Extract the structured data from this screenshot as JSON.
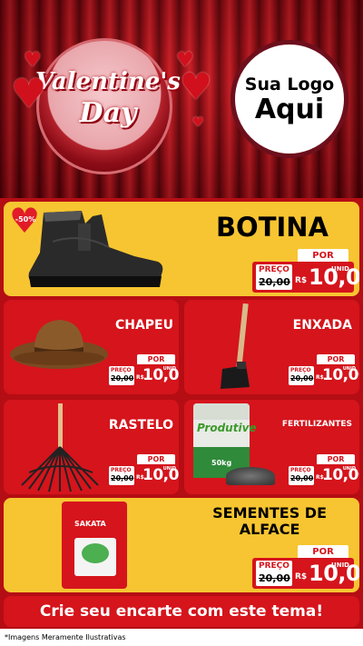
{
  "header": {
    "badge_line1": "Valentine's",
    "badge_line2": "Day",
    "logo_line1": "Sua Logo",
    "logo_line2": "Aqui"
  },
  "products": [
    {
      "name": "BOTINA",
      "discount": "-50%",
      "price_label": "PREÇO",
      "old_price": "20,00",
      "por_label": "POR",
      "currency": "R$",
      "price": "10,00",
      "unit": "UNID"
    },
    {
      "name": "CHAPEU",
      "price_label": "PREÇO",
      "old_price": "20,00",
      "por_label": "POR",
      "currency": "R$",
      "price": "10,00",
      "unit": "UNID"
    },
    {
      "name": "ENXADA",
      "price_label": "PREÇO",
      "old_price": "20,00",
      "por_label": "POR",
      "currency": "R$",
      "price": "10,00",
      "unit": "UNID"
    },
    {
      "name": "RASTELO",
      "price_label": "PREÇO",
      "old_price": "20,00",
      "por_label": "POR",
      "currency": "R$",
      "price": "10,00",
      "unit": "UNID"
    },
    {
      "name": "FERTILIZANTES",
      "package_brand": "Produtive",
      "package_weight": "50kg",
      "price_label": "PREÇO",
      "old_price": "20,00",
      "por_label": "POR",
      "currency": "R$",
      "price": "10,00",
      "unit": "UNID"
    },
    {
      "name_line1": "SEMENTES DE",
      "name_line2": "ALFACE",
      "package_brand": "SAKATA",
      "price_label": "PREÇO",
      "old_price": "20,00",
      "por_label": "POR",
      "currency": "R$",
      "price": "10,00",
      "unit": "UNID"
    }
  ],
  "banner": "Crie seu encarte com este tema!",
  "footnote": "*Imagens Meramente Ilustrativas",
  "colors": {
    "accent_red": "#d5141c",
    "accent_yellow": "#f7c531",
    "dark_red": "#b50d14"
  }
}
